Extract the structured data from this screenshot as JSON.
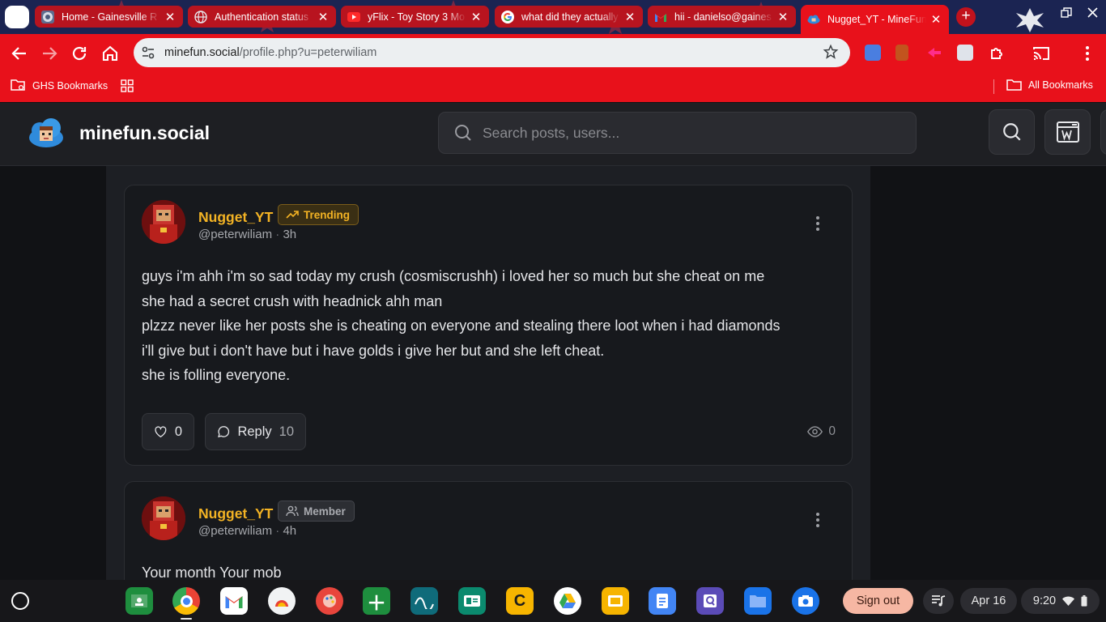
{
  "browser": {
    "tabs": [
      {
        "title": "Home - Gainesville R",
        "active": false
      },
      {
        "title": "Authentication status",
        "active": false
      },
      {
        "title": "yFlix - Toy Story 3 Mo",
        "active": false
      },
      {
        "title": "what did they actually",
        "active": false
      },
      {
        "title": "hii - danielso@gaines",
        "active": false
      },
      {
        "title": "Nugget_YT - MineFun",
        "active": true
      }
    ],
    "close_glyph": "✕",
    "new_tab_glyph": "+",
    "url": {
      "domain": "minefun.social",
      "path": "/profile.php?u=peterwiliam"
    },
    "bookmarks": {
      "left_folder": "GHS Bookmarks",
      "right_folder": "All Bookmarks"
    }
  },
  "site": {
    "name": "minefun.social",
    "search_placeholder": "Search posts, users..."
  },
  "posts": [
    {
      "author": "Nugget_YT",
      "badge": "Trending",
      "handle": "@peterwiliam",
      "time": "3h",
      "lines": [
        "guys i'm ahh i'm so sad today my crush (cosmiscrushh) i loved her so much but she cheat on me",
        "she had a secret crush with headnick ahh man",
        "plzzz never like her posts she is cheating on everyone and stealing there loot when i had diamonds",
        "i'll give but i don't have but i have golds i give her but and she left cheat.",
        "she is folling everyone."
      ],
      "likes": "0",
      "reply_label": "Reply",
      "replies": "10",
      "views": "0"
    },
    {
      "author": "Nugget_YT",
      "badge": "Member",
      "handle": "@peterwiliam",
      "time": "4h",
      "lines": [
        "Your month Your mob"
      ]
    }
  ],
  "meta_separator": "·",
  "shelf": {
    "signout": "Sign out",
    "date": "Apr 16",
    "time": "9:20"
  },
  "colors": {
    "chrome_red": "#e8111b",
    "tab_red": "#b8141f",
    "tabstrip_navy": "#1b2452",
    "username_gold": "#f3b324",
    "page_bg": "#111215",
    "card_bg": "#17191d"
  }
}
